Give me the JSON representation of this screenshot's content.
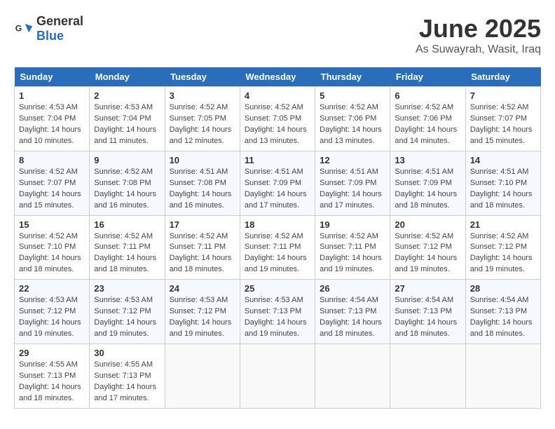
{
  "header": {
    "logo_general": "General",
    "logo_blue": "Blue",
    "month": "June 2025",
    "location": "As Suwayrah, Wasit, Iraq"
  },
  "weekdays": [
    "Sunday",
    "Monday",
    "Tuesday",
    "Wednesday",
    "Thursday",
    "Friday",
    "Saturday"
  ],
  "weeks": [
    [
      {
        "day": "1",
        "sunrise": "4:53 AM",
        "sunset": "7:04 PM",
        "daylight": "14 hours and 10 minutes."
      },
      {
        "day": "2",
        "sunrise": "4:53 AM",
        "sunset": "7:04 PM",
        "daylight": "14 hours and 11 minutes."
      },
      {
        "day": "3",
        "sunrise": "4:52 AM",
        "sunset": "7:05 PM",
        "daylight": "14 hours and 12 minutes."
      },
      {
        "day": "4",
        "sunrise": "4:52 AM",
        "sunset": "7:05 PM",
        "daylight": "14 hours and 13 minutes."
      },
      {
        "day": "5",
        "sunrise": "4:52 AM",
        "sunset": "7:06 PM",
        "daylight": "14 hours and 13 minutes."
      },
      {
        "day": "6",
        "sunrise": "4:52 AM",
        "sunset": "7:06 PM",
        "daylight": "14 hours and 14 minutes."
      },
      {
        "day": "7",
        "sunrise": "4:52 AM",
        "sunset": "7:07 PM",
        "daylight": "14 hours and 15 minutes."
      }
    ],
    [
      {
        "day": "8",
        "sunrise": "4:52 AM",
        "sunset": "7:07 PM",
        "daylight": "14 hours and 15 minutes."
      },
      {
        "day": "9",
        "sunrise": "4:52 AM",
        "sunset": "7:08 PM",
        "daylight": "14 hours and 16 minutes."
      },
      {
        "day": "10",
        "sunrise": "4:51 AM",
        "sunset": "7:08 PM",
        "daylight": "14 hours and 16 minutes."
      },
      {
        "day": "11",
        "sunrise": "4:51 AM",
        "sunset": "7:09 PM",
        "daylight": "14 hours and 17 minutes."
      },
      {
        "day": "12",
        "sunrise": "4:51 AM",
        "sunset": "7:09 PM",
        "daylight": "14 hours and 17 minutes."
      },
      {
        "day": "13",
        "sunrise": "4:51 AM",
        "sunset": "7:09 PM",
        "daylight": "14 hours and 18 minutes."
      },
      {
        "day": "14",
        "sunrise": "4:51 AM",
        "sunset": "7:10 PM",
        "daylight": "14 hours and 18 minutes."
      }
    ],
    [
      {
        "day": "15",
        "sunrise": "4:52 AM",
        "sunset": "7:10 PM",
        "daylight": "14 hours and 18 minutes."
      },
      {
        "day": "16",
        "sunrise": "4:52 AM",
        "sunset": "7:11 PM",
        "daylight": "14 hours and 18 minutes."
      },
      {
        "day": "17",
        "sunrise": "4:52 AM",
        "sunset": "7:11 PM",
        "daylight": "14 hours and 18 minutes."
      },
      {
        "day": "18",
        "sunrise": "4:52 AM",
        "sunset": "7:11 PM",
        "daylight": "14 hours and 19 minutes."
      },
      {
        "day": "19",
        "sunrise": "4:52 AM",
        "sunset": "7:11 PM",
        "daylight": "14 hours and 19 minutes."
      },
      {
        "day": "20",
        "sunrise": "4:52 AM",
        "sunset": "7:12 PM",
        "daylight": "14 hours and 19 minutes."
      },
      {
        "day": "21",
        "sunrise": "4:52 AM",
        "sunset": "7:12 PM",
        "daylight": "14 hours and 19 minutes."
      }
    ],
    [
      {
        "day": "22",
        "sunrise": "4:53 AM",
        "sunset": "7:12 PM",
        "daylight": "14 hours and 19 minutes."
      },
      {
        "day": "23",
        "sunrise": "4:53 AM",
        "sunset": "7:12 PM",
        "daylight": "14 hours and 19 minutes."
      },
      {
        "day": "24",
        "sunrise": "4:53 AM",
        "sunset": "7:12 PM",
        "daylight": "14 hours and 19 minutes."
      },
      {
        "day": "25",
        "sunrise": "4:53 AM",
        "sunset": "7:13 PM",
        "daylight": "14 hours and 19 minutes."
      },
      {
        "day": "26",
        "sunrise": "4:54 AM",
        "sunset": "7:13 PM",
        "daylight": "14 hours and 18 minutes."
      },
      {
        "day": "27",
        "sunrise": "4:54 AM",
        "sunset": "7:13 PM",
        "daylight": "14 hours and 18 minutes."
      },
      {
        "day": "28",
        "sunrise": "4:54 AM",
        "sunset": "7:13 PM",
        "daylight": "14 hours and 18 minutes."
      }
    ],
    [
      {
        "day": "29",
        "sunrise": "4:55 AM",
        "sunset": "7:13 PM",
        "daylight": "14 hours and 18 minutes."
      },
      {
        "day": "30",
        "sunrise": "4:55 AM",
        "sunset": "7:13 PM",
        "daylight": "14 hours and 17 minutes."
      },
      null,
      null,
      null,
      null,
      null
    ]
  ]
}
